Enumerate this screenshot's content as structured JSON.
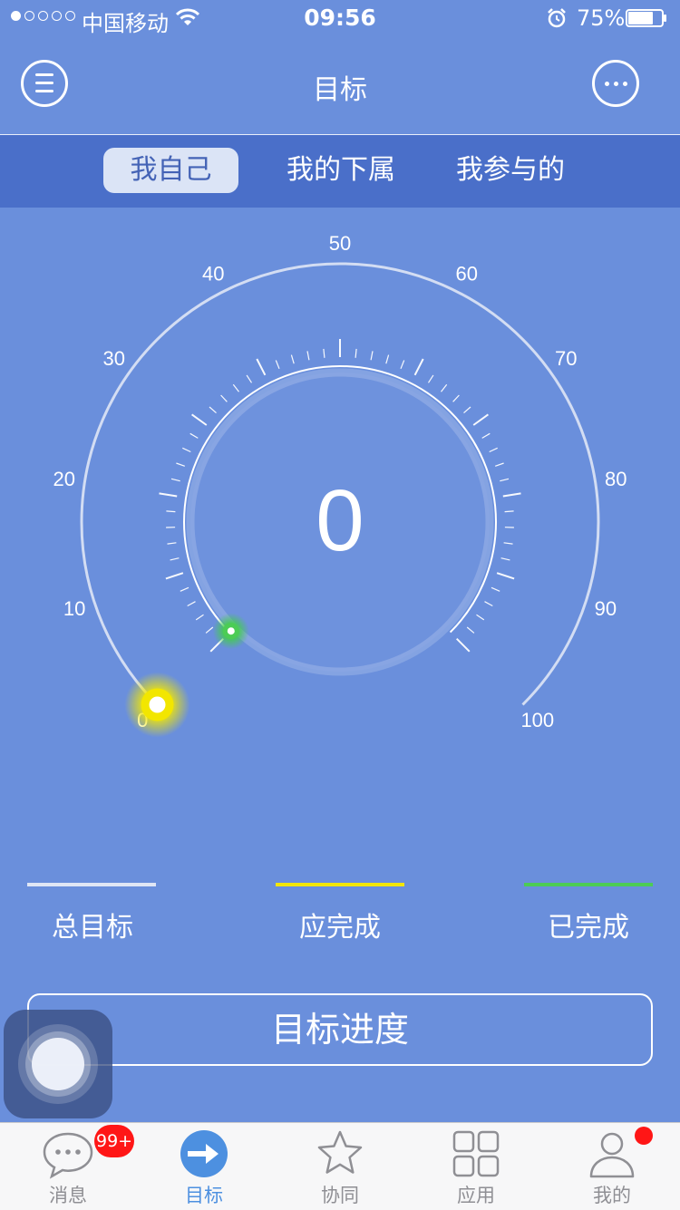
{
  "status_bar": {
    "signal_dots": [
      true,
      false,
      false,
      false,
      false
    ],
    "carrier": "中国移动",
    "time": "09:56",
    "battery_percent_label": "75%",
    "battery_level": 0.75,
    "icons": [
      "wifi-icon",
      "alarm-icon",
      "battery-icon"
    ]
  },
  "navbar": {
    "title": "目标",
    "left_icon": "menu-icon",
    "right_icon": "more-icon"
  },
  "segments": [
    {
      "label": "我自己",
      "active": true
    },
    {
      "label": "我的下属",
      "active": false
    },
    {
      "label": "我参与的",
      "active": false
    }
  ],
  "gauge": {
    "center_value": "0",
    "scale_labels": [
      "0",
      "10",
      "20",
      "30",
      "40",
      "50",
      "60",
      "70",
      "80",
      "90",
      "100"
    ],
    "scale_min": 0,
    "scale_max": 100,
    "should_complete_value": 0,
    "completed_value": 0,
    "colors": {
      "total": "#dfe6f5",
      "should_complete": "#f2e600",
      "completed": "#4ccc55"
    }
  },
  "legend": [
    {
      "label": "总目标",
      "color": "#dfe6f5"
    },
    {
      "label": "应完成",
      "color": "#f2e600"
    },
    {
      "label": "已完成",
      "color": "#4ccc55"
    }
  ],
  "progress_button": "目标进度",
  "tabbar": {
    "tabs": [
      {
        "label": "消息",
        "icon": "chat-bubble-icon",
        "badge": "99+",
        "active": false
      },
      {
        "label": "目标",
        "icon": "arrow-circle-icon",
        "active": true
      },
      {
        "label": "协同",
        "icon": "star-icon",
        "active": false
      },
      {
        "label": "应用",
        "icon": "grid-icon",
        "active": false
      },
      {
        "label": "我的",
        "icon": "person-icon",
        "has_dot": true,
        "active": false
      }
    ]
  },
  "colors": {
    "background": "#6a8fdc",
    "segment_bar": "#4a6fc9",
    "accent": "#4d90e0",
    "badge": "#ff1616"
  }
}
